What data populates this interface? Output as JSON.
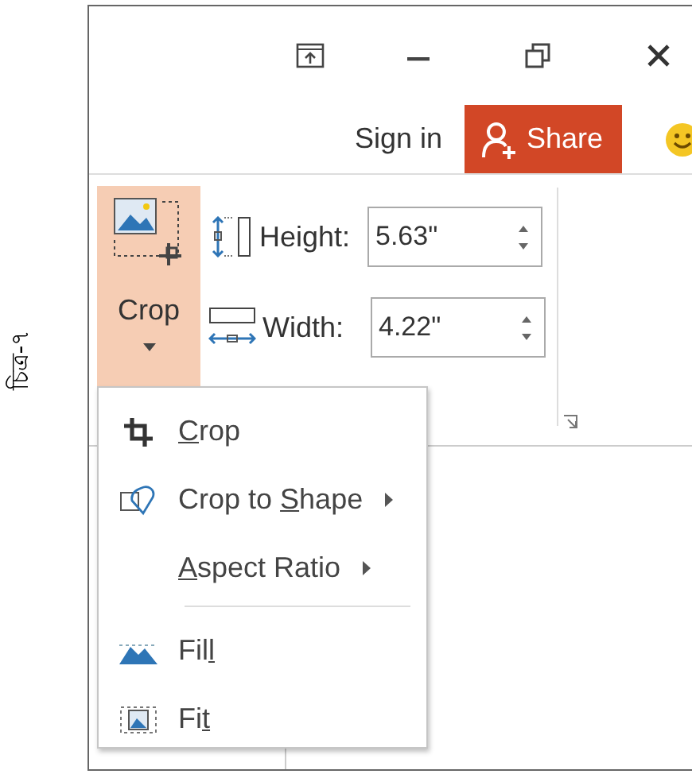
{
  "figure_label": "চিত্র-৭",
  "account": {
    "sign_in": "Sign in",
    "share": "Share"
  },
  "crop_button": {
    "label": "Crop",
    "pressed": true
  },
  "size": [
    {
      "kind": "height",
      "label": "Height:",
      "value": "5.63\""
    },
    {
      "kind": "width",
      "label": "Width:",
      "value": "4.22\""
    }
  ],
  "menu": [
    {
      "kind": "crop",
      "key": "C",
      "after": "rop",
      "submenu": false
    },
    {
      "kind": "shape",
      "before": "Crop to ",
      "key": "S",
      "after": "hape",
      "submenu": true
    },
    {
      "kind": "aspect",
      "key": "A",
      "after": "spect Ratio",
      "submenu": true
    },
    {
      "kind": "separator"
    },
    {
      "kind": "fill",
      "before": "Fil",
      "key": "l",
      "submenu": false
    },
    {
      "kind": "fit",
      "before": "Fi",
      "key": "t",
      "submenu": false
    }
  ]
}
